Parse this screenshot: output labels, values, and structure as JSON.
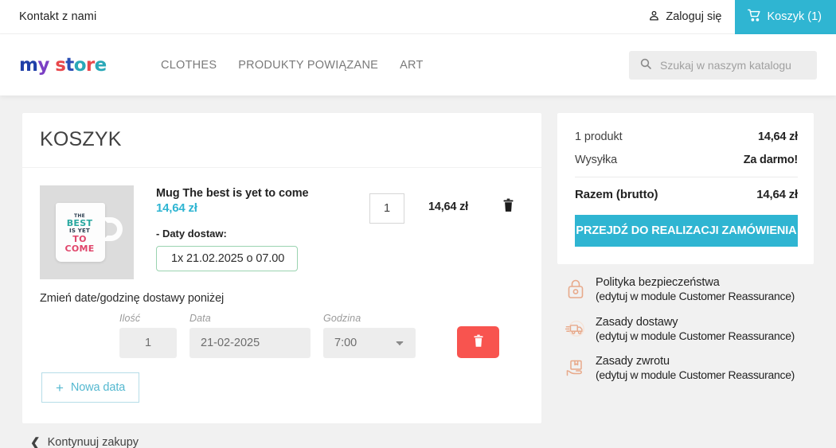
{
  "topbar": {
    "contact": "Kontakt z nami",
    "signin": "Zaloguj się",
    "signin_icon": "user-icon",
    "cart_label": "Koszyk (1)",
    "cart_icon": "shopping-cart-icon"
  },
  "header": {
    "logo": {
      "part1": "my",
      "part2": "store"
    },
    "nav": [
      {
        "label": "CLOTHES"
      },
      {
        "label": "PRODUKTY POWIĄZANE"
      },
      {
        "label": "ART"
      }
    ],
    "search": {
      "placeholder": "Szukaj w naszym katalogu",
      "value": "",
      "icon": "search-icon"
    }
  },
  "cart": {
    "title": "KOSZYK",
    "product": {
      "name": "Mug The best is yet to come",
      "unit_price": "14,64 zł",
      "quantity": "1",
      "line_total": "14,64 zł",
      "remove_icon": "trash-icon",
      "dates_label": "- Daty dostaw:",
      "date_badge": "1x 21.02.2025 o 07.00",
      "thumb_alt": "mug-thumbnail",
      "thumb_text": {
        "l1": "THE",
        "l2": "BEST",
        "l3": "IS YET",
        "l4": "TO",
        "l5": "COME"
      }
    },
    "change_section": {
      "heading": "Zmień date/godzinę dostawy poniżej",
      "fields": {
        "qty_label": "Ilość",
        "qty_value": "1",
        "date_label": "Data",
        "date_value": "21-02-2025",
        "time_label": "Godzina",
        "time_value": "7:00",
        "time_options": [
          "7:00"
        ]
      },
      "delete_icon": "trash-icon",
      "add_button": "Nowa data",
      "add_icon": "plus-icon"
    },
    "continue": {
      "label": "Kontynuuj zakupy",
      "icon": "chevron-left-icon"
    }
  },
  "summary": {
    "lines": [
      {
        "key": "1 produkt",
        "value": "14,64 zł"
      },
      {
        "key": "Wysyłka",
        "value": "Za darmo!"
      }
    ],
    "total": {
      "key": "Razem (brutto)",
      "value": "14,64 zł"
    },
    "checkout": "PRZEJDŹ DO REALIZACJI ZAMÓWIENIA"
  },
  "reassurance": [
    {
      "icon": "lock-icon",
      "title": "Polityka bezpieczeństwa",
      "sub": "(edytuj w module Customer Reassurance)"
    },
    {
      "icon": "delivery-truck-icon",
      "title": "Zasady dostawy",
      "sub": "(edytuj w module Customer Reassurance)"
    },
    {
      "icon": "return-box-icon",
      "title": "Zasady zwrotu",
      "sub": "(edytuj w module Customer Reassurance)"
    }
  ],
  "colors": {
    "accent": "#2fb5d2",
    "danger": "#f8544f",
    "badge_border": "#9ad3b0",
    "reassure_icon": "#e8a98a"
  }
}
